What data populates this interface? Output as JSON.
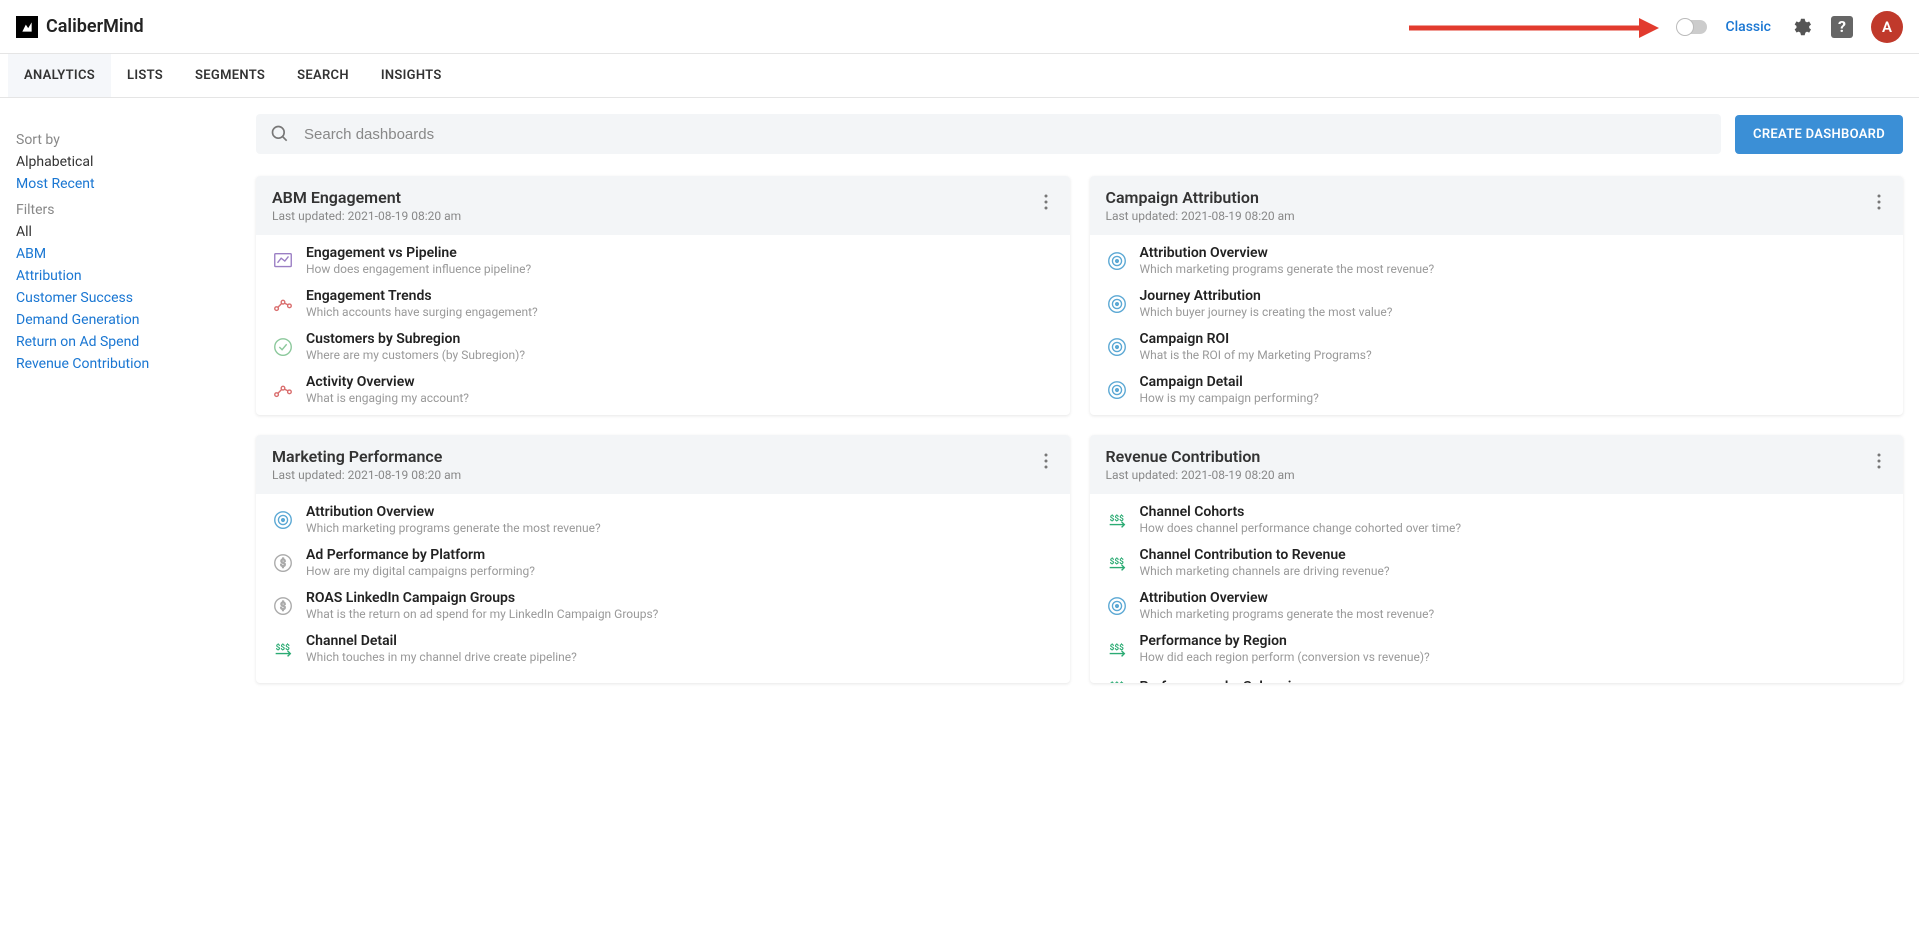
{
  "brand": "CaliberMind",
  "topRight": {
    "classicLabel": "Classic",
    "avatarInitial": "A"
  },
  "tabs": [
    {
      "label": "ANALYTICS",
      "active": true
    },
    {
      "label": "LISTS"
    },
    {
      "label": "SEGMENTS"
    },
    {
      "label": "SEARCH"
    },
    {
      "label": "INSIGHTS"
    }
  ],
  "sidebar": {
    "sortLabel": "Sort by",
    "sortOptions": [
      {
        "label": "Alphabetical",
        "active": false
      },
      {
        "label": "Most Recent",
        "active": true
      }
    ],
    "filtersLabel": "Filters",
    "filters": [
      {
        "label": "All",
        "active": false
      },
      {
        "label": "ABM",
        "active": true
      },
      {
        "label": "Attribution",
        "active": true
      },
      {
        "label": "Customer Success",
        "active": true
      },
      {
        "label": "Demand Generation",
        "active": true
      },
      {
        "label": "Return on Ad Spend",
        "active": true
      },
      {
        "label": "Revenue Contribution",
        "active": true
      }
    ]
  },
  "search": {
    "placeholder": "Search dashboards",
    "createButton": "CREATE DASHBOARD"
  },
  "cards": [
    {
      "title": "ABM Engagement",
      "updated": "Last updated: 2021-08-19 08:20 am",
      "items": [
        {
          "icon": "chart",
          "title": "Engagement vs Pipeline",
          "desc": "How does engagement influence pipeline?"
        },
        {
          "icon": "trend",
          "title": "Engagement Trends",
          "desc": "Which accounts have surging engagement?"
        },
        {
          "icon": "check",
          "title": "Customers by Subregion",
          "desc": "Where are my customers (by Subregion)?"
        },
        {
          "icon": "trend",
          "title": "Activity Overview",
          "desc": "What is engaging my account?"
        }
      ]
    },
    {
      "title": "Campaign Attribution",
      "updated": "Last updated: 2021-08-19 08:20 am",
      "items": [
        {
          "icon": "target",
          "title": "Attribution Overview",
          "desc": "Which marketing programs generate the most revenue?"
        },
        {
          "icon": "target",
          "title": "Journey Attribution",
          "desc": "Which buyer journey is creating the most value?"
        },
        {
          "icon": "target",
          "title": "Campaign ROI",
          "desc": "What is the ROI of my Marketing Programs?"
        },
        {
          "icon": "target",
          "title": "Campaign Detail",
          "desc": "How is my campaign performing?"
        }
      ]
    },
    {
      "title": "Marketing Performance",
      "updated": "Last updated: 2021-08-19 08:20 am",
      "items": [
        {
          "icon": "target",
          "title": "Attribution Overview",
          "desc": "Which marketing programs generate the most revenue?"
        },
        {
          "icon": "dollar",
          "title": "Ad Performance by Platform",
          "desc": "How are my digital campaigns performing?"
        },
        {
          "icon": "dollar",
          "title": "ROAS LinkedIn Campaign Groups",
          "desc": "What is the return on ad spend for my LinkedIn Campaign Groups?"
        },
        {
          "icon": "money",
          "title": "Channel Detail",
          "desc": "Which touches in my channel drive create pipeline?"
        }
      ]
    },
    {
      "title": "Revenue Contribution",
      "updated": "Last updated: 2021-08-19 08:20 am",
      "clipped": true,
      "items": [
        {
          "icon": "money",
          "title": "Channel Cohorts",
          "desc": "How does channel performance change cohorted over time?"
        },
        {
          "icon": "money",
          "title": "Channel Contribution to Revenue",
          "desc": "Which marketing channels are driving revenue?"
        },
        {
          "icon": "target",
          "title": "Attribution Overview",
          "desc": "Which marketing programs generate the most revenue?"
        },
        {
          "icon": "money",
          "title": "Performance by Region",
          "desc": "How did each region perform (conversion vs revenue)?"
        },
        {
          "icon": "money",
          "title": "Performance by Subregion",
          "desc": ""
        }
      ]
    }
  ]
}
